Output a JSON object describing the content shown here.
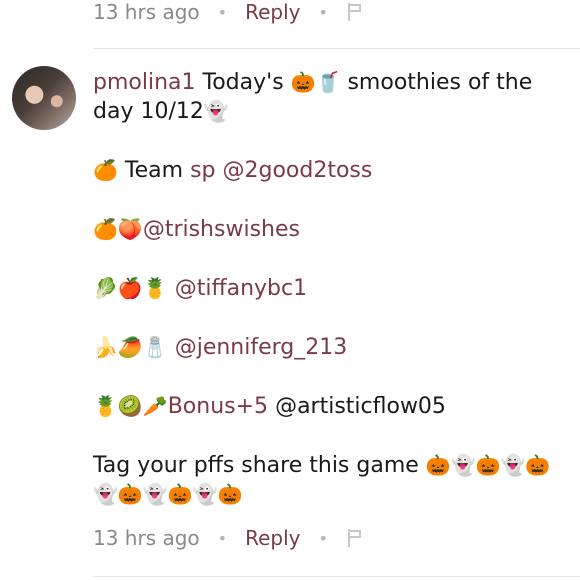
{
  "top_meta": {
    "time": "13 hrs ago",
    "reply": "Reply"
  },
  "comment": {
    "username": "pmolina1",
    "line1_text": "Today's",
    "line1_emoji": "🎃🥤",
    "line1_rest": "smoothies of the day 10/12",
    "line1_end_emoji": "👻",
    "rows": [
      {
        "emoji": "🍊",
        "text": "Team",
        "mention": "sp @2good2toss"
      },
      {
        "emoji": "🍊🍑",
        "text": "",
        "mention": "@trishswishes"
      },
      {
        "emoji": "🥬🍎🍍",
        "text": "",
        "mention": "@tiffanybc1"
      },
      {
        "emoji": "🍌🥭🧂",
        "text": "",
        "mention": "@jenniferg_213"
      },
      {
        "emoji": "🍍🥝🥕",
        "text": "",
        "mention": "Bonus+5",
        "after": "@artisticflow05"
      }
    ],
    "closing_text": "Tag your pffs share this game",
    "closing_emoji": "🎃👻🎃👻🎃👻🎃👻🎃👻🎃"
  },
  "bottom_meta": {
    "time": "13 hrs ago",
    "reply": "Reply"
  },
  "icons": {
    "flag": "flag-icon",
    "avatar": "avatar"
  }
}
